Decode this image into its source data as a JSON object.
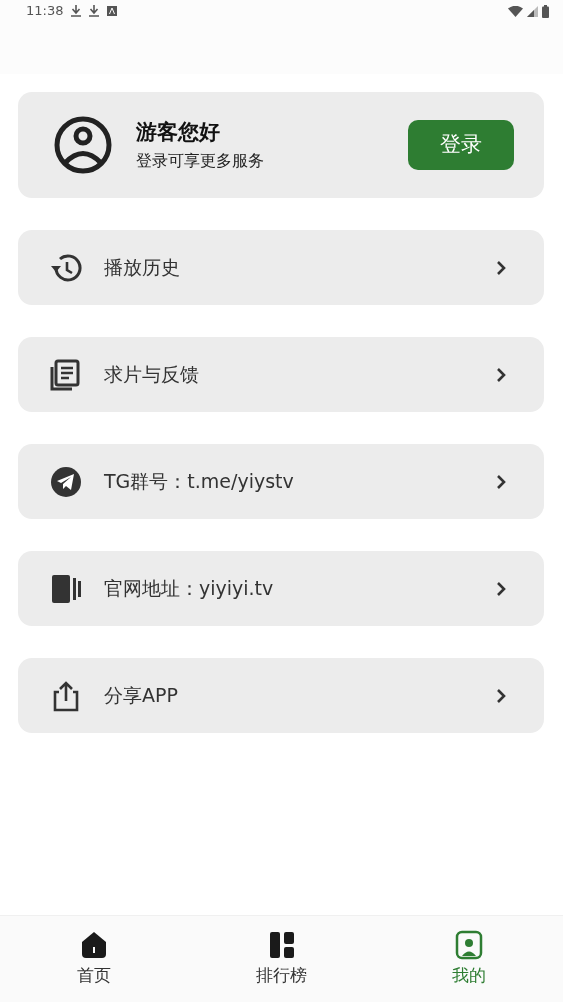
{
  "status_bar": {
    "time": "11:38"
  },
  "profile": {
    "greeting": "游客您好",
    "subtitle": "登录可享更多服务",
    "login_button": "登录"
  },
  "menu": [
    {
      "label": "播放历史"
    },
    {
      "label": "求片与反馈"
    },
    {
      "label": "TG群号：t.me/yiystv"
    },
    {
      "label": "官网地址：yiyiyi.tv"
    },
    {
      "label": "分享APP"
    }
  ],
  "tabs": [
    {
      "label": "首页",
      "selected": false
    },
    {
      "label": "排行榜",
      "selected": false
    },
    {
      "label": "我的",
      "selected": true
    }
  ]
}
